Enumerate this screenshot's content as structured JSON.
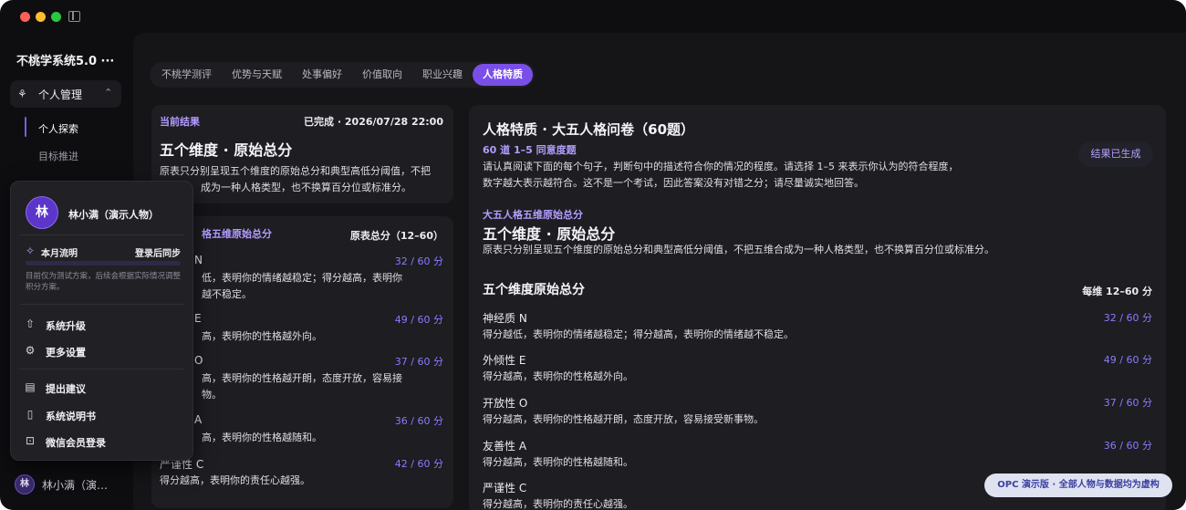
{
  "app": {
    "title": "不桃学系统5.0 ···"
  },
  "sidebar": {
    "group": {
      "label": "个人管理"
    },
    "items": [
      {
        "label": "个人探索",
        "active": true
      },
      {
        "label": "目标推进",
        "active": false
      }
    ],
    "user": {
      "avatar_char": "林",
      "name": "林小满（演…"
    }
  },
  "tabs": [
    {
      "label": "不桃学测评",
      "active": false
    },
    {
      "label": "优势与天赋",
      "active": false
    },
    {
      "label": "处事偏好",
      "active": false
    },
    {
      "label": "价值取向",
      "active": false
    },
    {
      "label": "职业兴趣",
      "active": false
    },
    {
      "label": "人格特质",
      "active": true
    }
  ],
  "current_result": {
    "label": "当前结果",
    "status": "已完成 · 2026/07/28 22:00",
    "title": "五个维度 · 原始总分",
    "desc_line1": "原表只分别呈现五个维度的原始总分和典型高低分阈值，不把",
    "desc_line2": "成为一种人格类型，也不换算百分位或标准分。"
  },
  "scores_card": {
    "label": "格五维原始总分",
    "range_label": "原表总分（12–60）",
    "rows": [
      {
        "letter": "N",
        "score": "32 / 60 分",
        "desc1": "低，表明你的情绪越稳定；得分越高，表明你",
        "desc2": "越不稳定。"
      },
      {
        "letter": "E",
        "score": "49 / 60 分",
        "desc1": "高，表明你的性格越外向。",
        "desc2": ""
      },
      {
        "letter": "O",
        "score": "37 / 60 分",
        "desc1": "高，表明你的性格越开朗，态度开放，容易接",
        "desc2": "物。"
      },
      {
        "letter": "A",
        "score": "36 / 60 分",
        "desc1": "高，表明你的性格越随和。",
        "desc2": ""
      },
      {
        "letter": "严谨性 C",
        "score": "42 / 60 分",
        "desc1": "得分越高，表明你的责任心越强。",
        "desc2": ""
      }
    ]
  },
  "questionnaire": {
    "title": "人格特质 · 大五人格问卷（60题）",
    "subtitle": "60 道 1–5 同意度题",
    "status_pill": "结果已生成",
    "intro1": "请认真阅读下面的每个句子，判断句中的描述符合你的情况的程度。请选择 1–5 来表示你认为的符合程度，",
    "intro2": "数字越大表示越符合。这不是一个考试，因此答案没有对错之分；请尽量诚实地回答。",
    "section_label": "大五人格五维原始总分",
    "section_title": "五个维度 · 原始总分",
    "section_desc": "原表只分别呈现五个维度的原始总分和典型高低分阈值，不把五维合成为一种人格类型，也不换算百分位或标准分。",
    "scores_title": "五个维度原始总分",
    "scores_range": "每维 12–60 分",
    "dims": [
      {
        "name": "神经质 N",
        "score": "32 / 60 分",
        "desc": "得分越低，表明你的情绪越稳定；得分越高，表明你的情绪越不稳定。"
      },
      {
        "name": "外倾性 E",
        "score": "49 / 60 分",
        "desc": "得分越高，表明你的性格越外向。"
      },
      {
        "name": "开放性 O",
        "score": "37 / 60 分",
        "desc": "得分越高，表明你的性格越开朗，态度开放，容易接受新事物。"
      },
      {
        "name": "友善性 A",
        "score": "36 / 60 分",
        "desc": "得分越高，表明你的性格越随和。"
      },
      {
        "name": "严谨性 C",
        "score": "",
        "desc": "得分越高，表明你的责任心越强。"
      }
    ]
  },
  "popover": {
    "avatar_char": "林",
    "name": "林小满（演示人物）",
    "flow_label": "本月流明",
    "flow_sync": "登录后同步",
    "flow_progress": 0,
    "note": "目前仅为测试方案，后续会根据实际情况调整积分方案。",
    "items": [
      {
        "label": "系统升级",
        "icon": "upgrade-arrow-icon"
      },
      {
        "label": "更多设置",
        "icon": "gear-icon"
      },
      {
        "label": "提出建议",
        "icon": "feedback-icon"
      },
      {
        "label": "系统说明书",
        "icon": "manual-icon"
      },
      {
        "label": "微信会员登录",
        "icon": "lock-icon"
      }
    ]
  },
  "demo_badge": "OPC 演示版 · 全部人物与数据均为虚构",
  "colors": {
    "accent": "#7a4fe8",
    "score": "#8a7cff",
    "label": "#b39cff",
    "background": "#0e0e11"
  }
}
